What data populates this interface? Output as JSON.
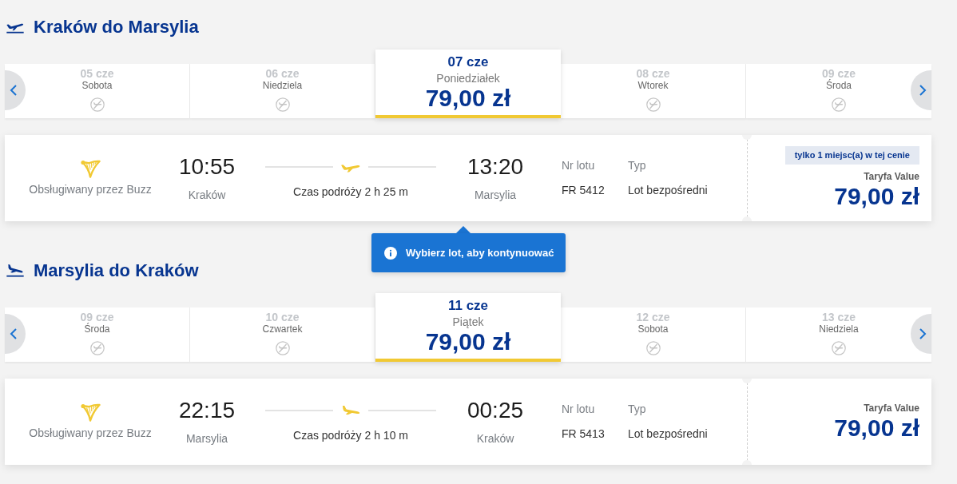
{
  "sections": [
    {
      "kind": "outbound",
      "title": "Kraków do Marsylia",
      "dates": [
        {
          "date": "05 cze",
          "day": "Sobota",
          "selected": false
        },
        {
          "date": "06 cze",
          "day": "Niedziela",
          "selected": false
        },
        {
          "date": "07 cze",
          "day": "Poniedziałek",
          "price": "79,00 zł",
          "selected": true
        },
        {
          "date": "08 cze",
          "day": "Wtorek",
          "selected": false
        },
        {
          "date": "09 cze",
          "day": "Środa",
          "selected": false
        }
      ],
      "flight": {
        "operator": "Obsługiwany przez Buzz",
        "departure_time": "10:55",
        "departure_city": "Kraków",
        "duration": "Czas podróży 2 h 25 m",
        "arrival_time": "13:20",
        "arrival_city": "Marsylia",
        "flight_number_label": "Nr lotu",
        "flight_number": "FR 5412",
        "type_label": "Typ",
        "type": "Lot bezpośredni",
        "badge": "tylko 1 miejsc(a) w tej cenie",
        "fare": "Taryfa Value",
        "price": "79,00 zł"
      }
    },
    {
      "kind": "return",
      "title": "Marsylia do Kraków",
      "dates": [
        {
          "date": "09 cze",
          "day": "Środa",
          "selected": false
        },
        {
          "date": "10 cze",
          "day": "Czwartek",
          "selected": false
        },
        {
          "date": "11 cze",
          "day": "Piątek",
          "price": "79,00 zł",
          "selected": true
        },
        {
          "date": "12 cze",
          "day": "Sobota",
          "selected": false
        },
        {
          "date": "13 cze",
          "day": "Niedziela",
          "selected": false
        }
      ],
      "flight": {
        "operator": "Obsługiwany przez Buzz",
        "departure_time": "22:15",
        "departure_city": "Marsylia",
        "duration": "Czas podróży 2 h 10 m",
        "arrival_time": "00:25",
        "arrival_city": "Kraków",
        "flight_number_label": "Nr lotu",
        "flight_number": "FR 5413",
        "type_label": "Typ",
        "type": "Lot bezpośredni",
        "fare": "Taryfa Value",
        "price": "79,00 zł"
      }
    }
  ],
  "tooltip": {
    "text": "Wybierz lot, aby kontynuować"
  }
}
